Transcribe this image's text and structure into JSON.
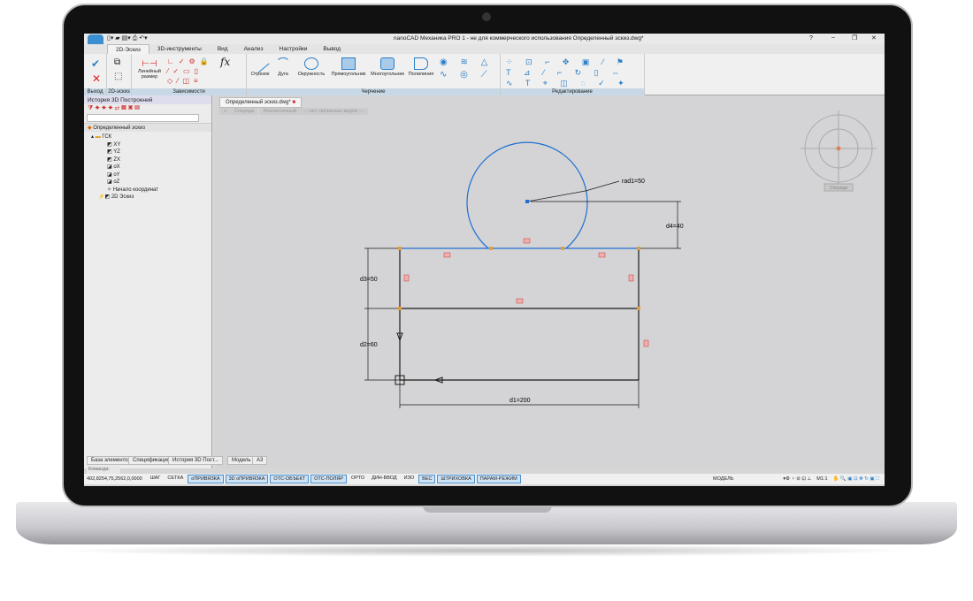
{
  "window": {
    "title": "nanoCAD Механика PRO 1 - не для коммерческого использования Определенный эскиз.dwg*",
    "help": "?",
    "minimize": "–",
    "restore": "❐",
    "close": "✕"
  },
  "ribbon_tabs": [
    "2D-Эскиз",
    "3D-инструменты",
    "Вид",
    "Анализ",
    "Настройки",
    "Вывод"
  ],
  "ribbon": {
    "exit_group": "Выход",
    "sketch_group": "2D-эскиз",
    "constraints_group": "Зависимости",
    "drawing_group": "Черчение",
    "edit_group": "Редактирование",
    "linear_dim": "Линейный размер",
    "fx": "fx",
    "tools": [
      "Отрезок",
      "Дуга",
      "Окружность",
      "Прямоугольник",
      "Многоугольник",
      "Полилиния"
    ]
  },
  "side_panel": {
    "title": "История 3D Построений",
    "root": "Определенный эскиз",
    "tree": [
      "ГСК",
      "XY",
      "YZ",
      "ZX",
      "oX",
      "oY",
      "oZ",
      "Начало координат",
      "2D Эскиз"
    ],
    "bottom_tabs": [
      "База элементов",
      "Спецификация",
      "История 3D Пост..."
    ]
  },
  "document": {
    "tab": "Определенный эскиз.dwg*",
    "view_buttons": [
      "+",
      "Спереди",
      "Реалистичный",
      "--- нет связанных видов ---"
    ],
    "viewcube_label": "Спереди"
  },
  "drawing": {
    "dims": {
      "rad": "rad1=50",
      "d4": "d4=40",
      "d3": "d3=50",
      "d2": "d2=60",
      "d1": "d1=200"
    },
    "line_color": "#1a1a1a",
    "circle_color": "#1f6fd0"
  },
  "layout_tabs": [
    "Модель",
    "А3"
  ],
  "command_label": "Команда:",
  "status": {
    "coords": "402,8254,75,2562,0,0000",
    "toggles": [
      {
        "label": "ШАГ",
        "on": false
      },
      {
        "label": "СЕТКА",
        "on": false
      },
      {
        "label": "оПРИВЯЗКА",
        "on": true
      },
      {
        "label": "3D оПРИВЯЗКА",
        "on": true
      },
      {
        "label": "ОТС-ОБЪЕКТ",
        "on": true
      },
      {
        "label": "ОТС-ПОЛЯР",
        "on": true
      },
      {
        "label": "ОРТО",
        "on": false
      },
      {
        "label": "ДИН-ВВОД",
        "on": false
      },
      {
        "label": "ИЗО",
        "on": false
      },
      {
        "label": "ВЕС",
        "on": true
      },
      {
        "label": "ШТРИХОВКА",
        "on": true
      },
      {
        "label": "ПАРАМ-РЕЖИМ",
        "on": true
      }
    ],
    "model": "МОДЕЛЬ",
    "scale": "М1:1"
  }
}
